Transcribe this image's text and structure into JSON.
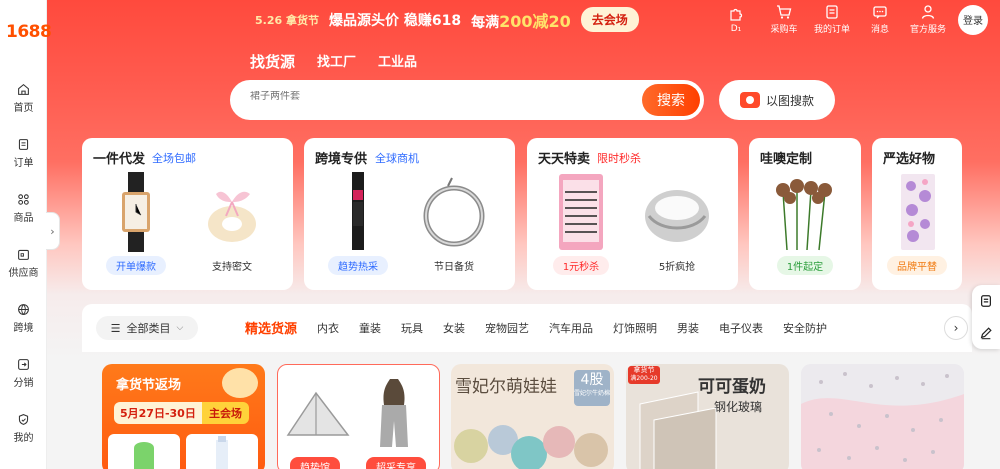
{
  "logo": "1688",
  "sidebar": {
    "items": [
      {
        "label": "首页",
        "icon": "home-icon"
      },
      {
        "label": "订单",
        "icon": "order-icon"
      },
      {
        "label": "商品",
        "icon": "grid-icon"
      },
      {
        "label": "供应商",
        "icon": "store-icon"
      },
      {
        "label": "跨境",
        "icon": "globe-icon"
      },
      {
        "label": "分销",
        "icon": "share-icon"
      },
      {
        "label": "我的",
        "icon": "shield-user-icon"
      }
    ],
    "toggle": "›"
  },
  "promo": {
    "date_tag": "5.26 拿货节",
    "line1": "爆品源头价 稳赚618",
    "line2_prefix": "每满",
    "line2_amount": "200减20",
    "cta": "去会场"
  },
  "top_nav": [
    {
      "label": "D₁",
      "icon": "puzzle-icon"
    },
    {
      "label": "采购车",
      "icon": "cart-icon"
    },
    {
      "label": "我的订单",
      "icon": "order-list-icon"
    },
    {
      "label": "消息",
      "icon": "message-icon"
    },
    {
      "label": "官方服务",
      "icon": "user-icon"
    }
  ],
  "login": "登录",
  "search": {
    "tabs": [
      "找货源",
      "找工厂",
      "工业品"
    ],
    "placeholder": "裙子两件套",
    "button": "搜索",
    "image_search": "以图搜款"
  },
  "cards": [
    {
      "title": "一件代发",
      "subtitle": "全场包邮",
      "subtitle_color": "#2f6bff",
      "tiles": [
        {
          "tag": "开单爆款",
          "tag_style": "blue"
        },
        {
          "tag": "支持密文",
          "tag_style": "plain"
        }
      ]
    },
    {
      "title": "跨境专供",
      "subtitle": "全球商机",
      "subtitle_color": "#2f6bff",
      "tiles": [
        {
          "tag": "趋势热采",
          "tag_style": "blue"
        },
        {
          "tag": "节日备货",
          "tag_style": "plain"
        }
      ]
    },
    {
      "title": "天天特卖",
      "subtitle": "限时秒杀",
      "subtitle_color": "#ff2a2a",
      "tiles": [
        {
          "tag": "1元秒杀",
          "tag_style": "red"
        },
        {
          "tag": "5折疯抢",
          "tag_style": "plain"
        }
      ]
    },
    {
      "title": "哇噢定制",
      "subtitle": "",
      "tiles": [
        {
          "tag": "1件起定",
          "tag_style": "green"
        }
      ]
    },
    {
      "title": "严选好物",
      "subtitle": "",
      "tiles": [
        {
          "tag": "品牌平替",
          "tag_style": "orange"
        }
      ]
    }
  ],
  "categories": {
    "all_label": "全部类目",
    "items": [
      "精选货源",
      "内衣",
      "童装",
      "玩具",
      "女装",
      "宠物园艺",
      "汽车用品",
      "灯饰照明",
      "男装",
      "电子仪表",
      "安全防护"
    ],
    "next": "›"
  },
  "products": {
    "p1_title": "拿货节返场",
    "p1_date": "5月27日-30日",
    "p1_badge": "主会场",
    "p2_tag1": "趋势馆",
    "p2_tag2": "超采专享",
    "p3_title": "雪妃尔萌娃娃",
    "p3_badge": "4股",
    "p3_badge_sub": "雪妃尔牛奶棉",
    "p4_tag": "拿货节",
    "p4_tag_sub": "满200-20",
    "p4_title": "可可蛋奶",
    "p4_subtitle": "钢化玻璃"
  }
}
